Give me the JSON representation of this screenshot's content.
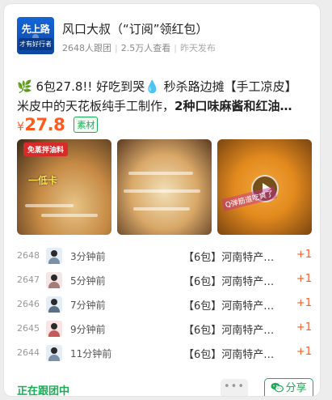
{
  "header": {
    "logo_top": "先上路",
    "logo_bottom": "才有好行者",
    "title": "风口大叔（“订阅”领红包）",
    "followers": "2648人跟团",
    "views": "2.5万人查看",
    "published": "昨天发布"
  },
  "post": {
    "line1": "🌿 6包27.8!! 好吃到哭💧 秒杀路边摊【手工凉皮】",
    "line2_prefix": "米皮中的天花板纯手工制作，",
    "line2_bold": "2种口味麻酱和红油…",
    "price_symbol": "¥",
    "price": "27.8",
    "tag": "素材",
    "img1_badge": "免蒸拌油料",
    "img1_caption": "一低卡",
    "img3_overlay": "Q弹筋道吃爽了"
  },
  "orders": [
    {
      "num": "2648",
      "time": "3分钟前",
      "item": "【6包】河南特产…",
      "plus": "+1"
    },
    {
      "num": "2647",
      "time": "5分钟前",
      "item": "【6包】河南特产…",
      "plus": "+1"
    },
    {
      "num": "2646",
      "time": "7分钟前",
      "item": "【6包】河南特产…",
      "plus": "+1"
    },
    {
      "num": "2645",
      "time": "9分钟前",
      "item": "【6包】河南特产…",
      "plus": "+1"
    },
    {
      "num": "2644",
      "time": "11分钟前",
      "item": "【6包】河南特产…",
      "plus": "+1"
    }
  ],
  "footer": {
    "status": "正在跟团中",
    "more": "•••",
    "share": "分享"
  },
  "colors": {
    "accent": "#1aad55",
    "price": "#ff5a1f"
  }
}
